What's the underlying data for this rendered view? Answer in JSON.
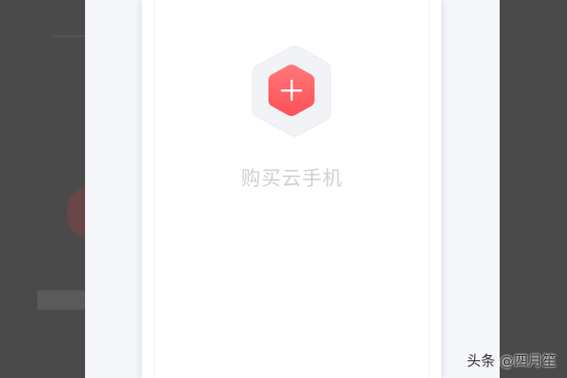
{
  "card": {
    "label": "购买云手机",
    "icon": "add-plus-icon",
    "accent": "#ff5a60",
    "accent_light": "#ff8a8a"
  },
  "watermark": {
    "text": "头条 @四月笙"
  }
}
